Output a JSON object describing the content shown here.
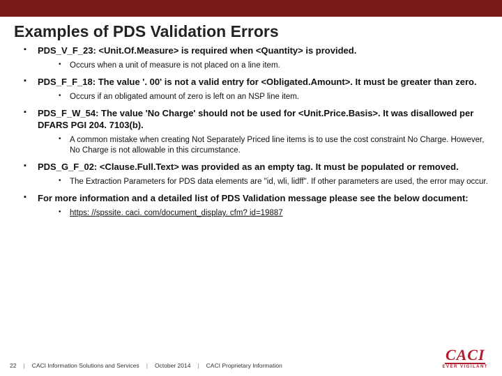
{
  "title": "Examples of PDS Validation Errors",
  "items": [
    {
      "heading": "PDS_V_F_23: <Unit.Of.Measure> is required when <Quantity> is provided.",
      "sub": [
        "Occurs when a unit of measure is not placed on a line item."
      ]
    },
    {
      "heading": "PDS_F_F_18: The value '. 00' is not a valid entry for <Obligated.Amount>. It must be greater than zero.",
      "sub": [
        "Occurs if an obligated amount of zero is left on an NSP line item."
      ]
    },
    {
      "heading": "PDS_F_W_54: The value 'No Charge' should not be used for <Unit.Price.Basis>. It was disallowed per DFARS PGI 204. 7103(b).",
      "sub": [
        "A common mistake when creating Not Separately Priced line items is to use the cost constraint No Charge. However, No Charge is not allowable in this circumstance."
      ]
    },
    {
      "heading": "PDS_G_F_02: <Clause.Full.Text> was provided as an empty tag. It must be populated or removed.",
      "sub": [
        "The Extraction Parameters for PDS data elements are \"id, wli, lidff\". If other parameters are used, the error may occur."
      ]
    },
    {
      "heading": "For more information and a detailed list of PDS Validation message please see the below document:",
      "sub_link": "https: //spssite. caci. com/document_display. cfm? id=19887"
    }
  ],
  "footer": {
    "page": "22",
    "org": "CACI Information Solutions and Services",
    "date": "October 2014",
    "class": "CACI Proprietary Information"
  },
  "logo": {
    "name": "CACI",
    "tag": "EVER VIGILANT"
  }
}
